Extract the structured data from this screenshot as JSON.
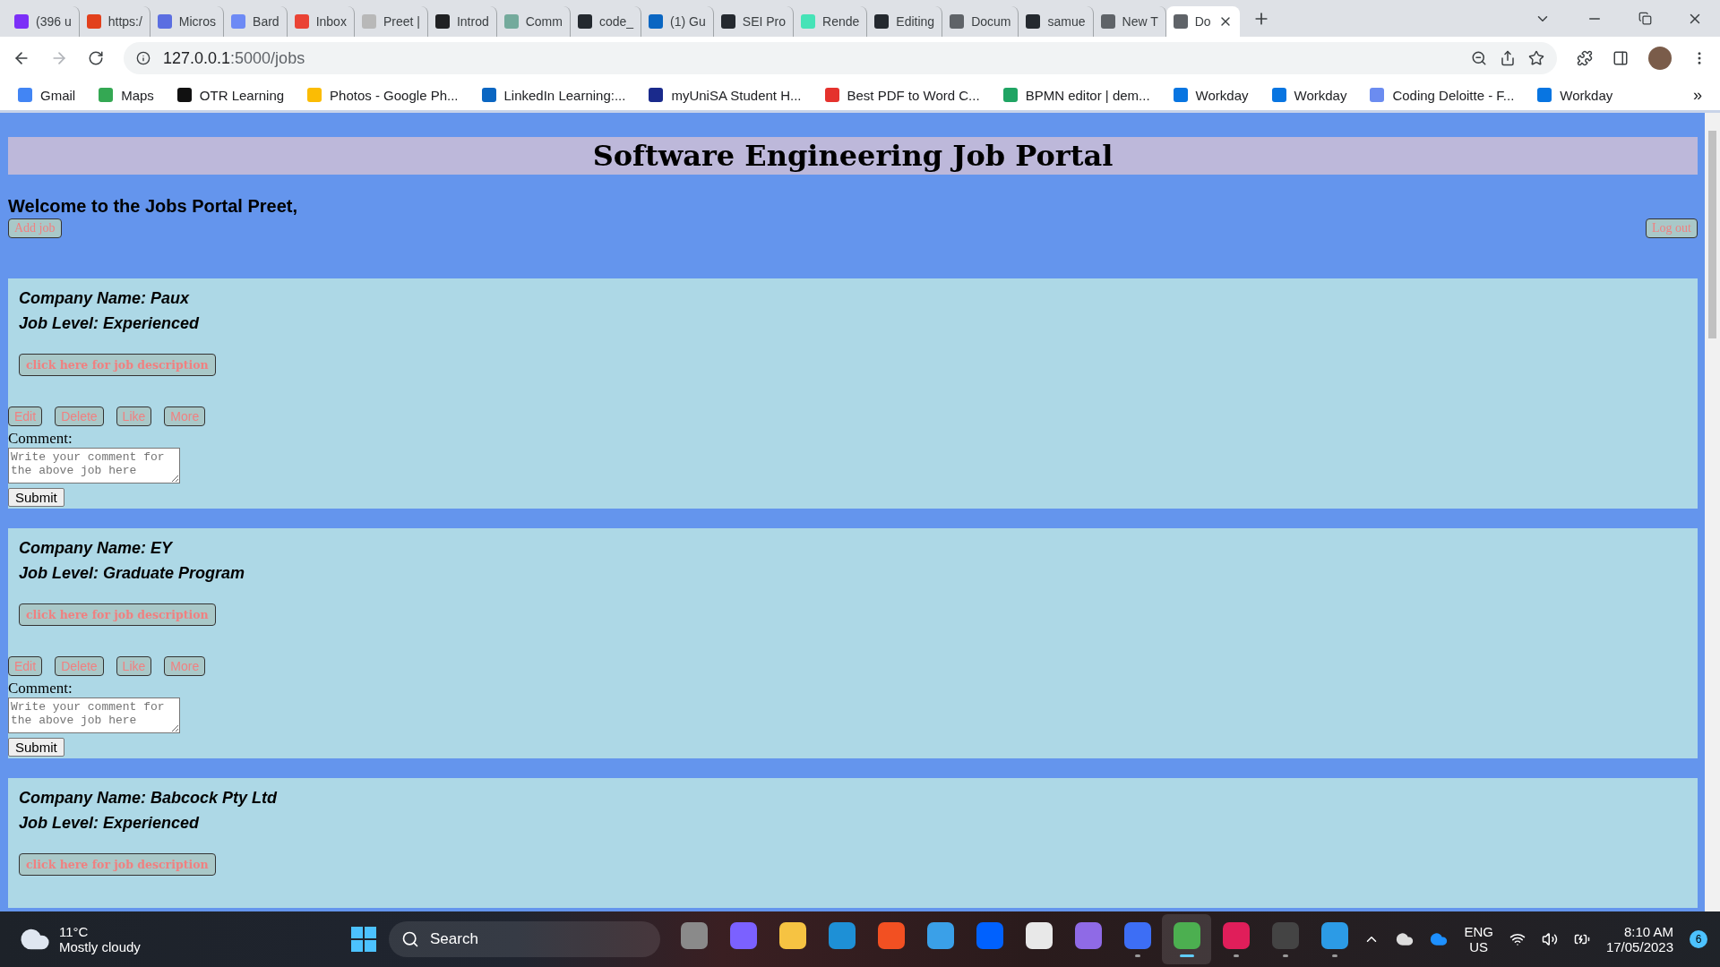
{
  "browser": {
    "tabs": [
      {
        "label": "(396 u",
        "color": "#7b2ff7",
        "selected": false
      },
      {
        "label": "https:/",
        "color": "#e2401c",
        "selected": false
      },
      {
        "label": "Micros",
        "color": "#5b6ee1",
        "selected": false
      },
      {
        "label": "Bard",
        "color": "#6d8af5",
        "selected": false
      },
      {
        "label": "Inbox",
        "color": "#ea4335",
        "selected": false
      },
      {
        "label": "Preet |",
        "color": "#b8b8b8",
        "selected": false
      },
      {
        "label": "Introd",
        "color": "#202123",
        "selected": false
      },
      {
        "label": "Comm",
        "color": "#74aa9c",
        "selected": false
      },
      {
        "label": "code_",
        "color": "#24292f",
        "selected": false
      },
      {
        "label": "(1) Gu",
        "color": "#0a66c2",
        "selected": false
      },
      {
        "label": "SEI Pro",
        "color": "#24292f",
        "selected": false
      },
      {
        "label": "Rende",
        "color": "#46e3b7",
        "selected": false
      },
      {
        "label": "Editing",
        "color": "#24292f",
        "selected": false
      },
      {
        "label": "Docum",
        "color": "#5f6368",
        "selected": false
      },
      {
        "label": "samue",
        "color": "#24292f",
        "selected": false
      },
      {
        "label": "New T",
        "color": "#5f6368",
        "selected": false
      },
      {
        "label": "Do",
        "color": "#5f6368",
        "selected": true
      }
    ],
    "address": {
      "host": "127.0.0.1",
      "path": ":5000/jobs"
    },
    "bookmarks": [
      {
        "label": "Gmail",
        "color": "#4285f4"
      },
      {
        "label": "Maps",
        "color": "#34a853"
      },
      {
        "label": "OTR Learning",
        "color": "#111111"
      },
      {
        "label": "Photos - Google Ph...",
        "color": "#fbbc04"
      },
      {
        "label": "LinkedIn Learning:...",
        "color": "#0a66c2"
      },
      {
        "label": "myUniSA Student H...",
        "color": "#1a2a8c"
      },
      {
        "label": "Best PDF to Word C...",
        "color": "#e5322d"
      },
      {
        "label": "BPMN editor | dem...",
        "color": "#1fa463"
      },
      {
        "label": "Workday",
        "color": "#0875e1"
      },
      {
        "label": "Workday",
        "color": "#0875e1"
      },
      {
        "label": "Coding Deloitte - F...",
        "color": "#6b8cf0"
      },
      {
        "label": "Workday",
        "color": "#0875e1"
      }
    ],
    "bookmarks_more": "»"
  },
  "page": {
    "title": "Software Engineering Job Portal",
    "welcome": "Welcome to the Jobs Portal Preet,",
    "add_job": "Add job",
    "log_out": "Log out",
    "jobs": [
      {
        "company": "Company Name: Paux",
        "level": "Job Level: Experienced",
        "description_button": "click here for job description",
        "actions": [
          "Edit",
          "Delete",
          "Like",
          "More"
        ],
        "comment_label": "Comment:",
        "comment_placeholder": "Write your comment for the above job here",
        "submit": "Submit"
      },
      {
        "company": "Company Name: EY",
        "level": "Job Level: Graduate Program",
        "description_button": "click here for job description",
        "actions": [
          "Edit",
          "Delete",
          "Like",
          "More"
        ],
        "comment_label": "Comment:",
        "comment_placeholder": "Write your comment for the above job here",
        "submit": "Submit"
      },
      {
        "company": "Company Name: Babcock Pty Ltd",
        "level": "Job Level: Experienced",
        "description_button": "click here for job description"
      }
    ]
  },
  "taskbar": {
    "weather": {
      "temperature": "11°C",
      "condition": "Mostly cloudy"
    },
    "search": "Search",
    "apps": [
      {
        "color": "#8a8a8a",
        "running": false,
        "selected": false
      },
      {
        "color": "#7b61ff",
        "running": false,
        "selected": false
      },
      {
        "color": "#f6c342",
        "running": false,
        "selected": false
      },
      {
        "color": "#1e90d6",
        "running": false,
        "selected": false
      },
      {
        "color": "#f25022",
        "running": false,
        "selected": false
      },
      {
        "color": "#3aa0e8",
        "running": false,
        "selected": false
      },
      {
        "color": "#0061fe",
        "running": false,
        "selected": false
      },
      {
        "color": "#e8e8e8",
        "running": false,
        "selected": false
      },
      {
        "color": "#8f6ae6",
        "running": false,
        "selected": false
      },
      {
        "color": "#3d6ef5",
        "running": true,
        "selected": false
      },
      {
        "color": "#4caf50",
        "running": true,
        "selected": true
      },
      {
        "color": "#e01e5a",
        "running": true,
        "selected": false
      },
      {
        "color": "#444444",
        "running": true,
        "selected": false
      },
      {
        "color": "#2c9be6",
        "running": true,
        "selected": false
      }
    ],
    "language": "ENG",
    "region": "US",
    "time": "8:10 AM",
    "date": "17/05/2023",
    "notifications": "6"
  }
}
